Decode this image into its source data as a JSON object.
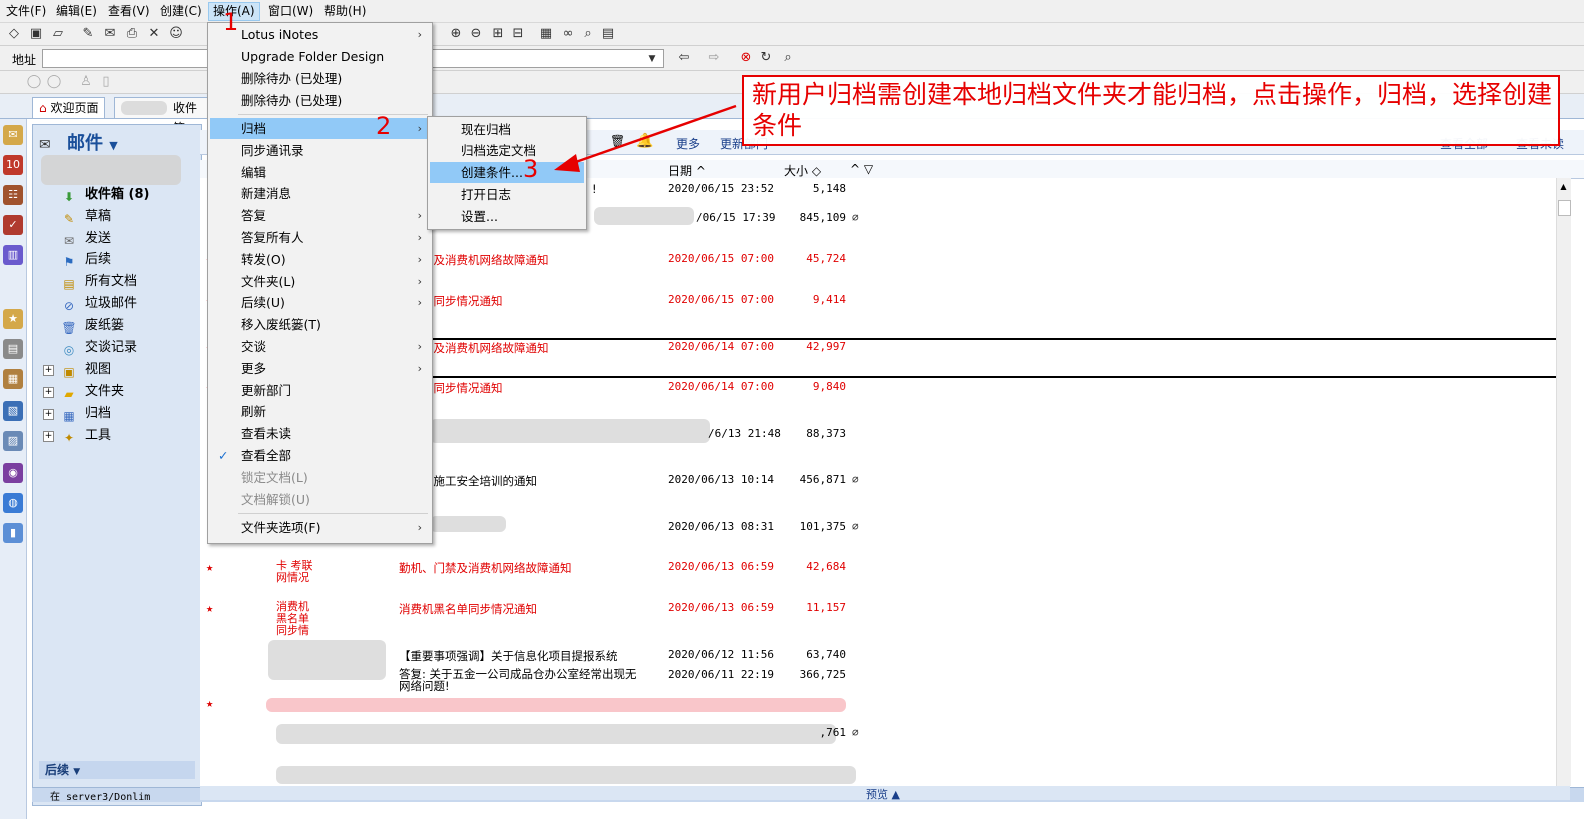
{
  "menubar": [
    {
      "label": "文件(F)"
    },
    {
      "label": "编辑(E)"
    },
    {
      "label": "查看(V)"
    },
    {
      "label": "创建(C)"
    },
    {
      "label": "操作(A)"
    },
    {
      "label": "窗口(W)"
    },
    {
      "label": "帮助(H)"
    }
  ],
  "address": {
    "label": "地址",
    "value": ""
  },
  "tabs": {
    "welcome": "欢迎页面",
    "inbox": "收件箱"
  },
  "nav": {
    "header": "邮件",
    "items": [
      {
        "label": "收件箱 (8)",
        "icon": "inbox-icon"
      },
      {
        "label": "草稿",
        "icon": "draft-icon"
      },
      {
        "label": "发送",
        "icon": "sent-icon"
      },
      {
        "label": "后续",
        "icon": "flag-icon"
      },
      {
        "label": "所有文档",
        "icon": "all-docs-icon"
      },
      {
        "label": "垃圾邮件",
        "icon": "junk-icon"
      },
      {
        "label": "废纸篓",
        "icon": "trash-icon"
      },
      {
        "label": "交谈记录",
        "icon": "conversations-icon"
      },
      {
        "label": "视图",
        "icon": "views-icon"
      },
      {
        "label": "文件夹",
        "icon": "folder-icon"
      },
      {
        "label": "归档",
        "icon": "archive-icon"
      },
      {
        "label": "工具",
        "icon": "tools-icon"
      }
    ],
    "followup": "后续",
    "status": "在 server3/Donlim"
  },
  "view_toolbar": {
    "more": "更多",
    "update_dept": "更新部门",
    "view_all": "查看全部",
    "view_unread": "查看未读"
  },
  "columns": {
    "date": "日期",
    "size": "大小"
  },
  "rows": [
    {
      "subject": "!",
      "date": "2020/06/15 23:52",
      "size": "5,148",
      "red": false,
      "star": false,
      "clip": false
    },
    {
      "subject": "",
      "date": "/06/15 17:39",
      "size": "845,109",
      "red": false,
      "star": false,
      "clip": true
    },
    {
      "subject": "、门禁及消费机网络故障通知",
      "date": "2020/06/15 07:00",
      "size": "45,724",
      "red": true,
      "star": true,
      "clip": false
    },
    {
      "subject": "黑名单同步情况通知",
      "date": "2020/06/15 07:00",
      "size": "9,414",
      "red": true,
      "star": true,
      "clip": false
    },
    {
      "subject": "、门禁及消费机网络故障通知",
      "date": "2020/06/14 07:00",
      "size": "42,997",
      "red": true,
      "star": true,
      "clip": false
    },
    {
      "subject": "黑名单同步情况通知",
      "date": "2020/06/14 07:00",
      "size": "9,840",
      "red": true,
      "star": true,
      "clip": false
    },
    {
      "subject": "",
      "date": "/6/13 21:48",
      "size": "88,373",
      "red": false,
      "star": false,
      "clip": false
    },
    {
      "subject": "电工程施工安全培训的通知",
      "date": "2020/06/13 10:14",
      "size": "456,871",
      "red": false,
      "star": false,
      "clip": true
    },
    {
      "subject": "",
      "date": "2020/06/13 08:31",
      "size": "101,375",
      "red": false,
      "star": false,
      "clip": true
    },
    {
      "subject": "勤机、门禁及消费机网络故障通知",
      "date": "2020/06/13 06:59",
      "size": "42,684",
      "red": true,
      "star": true,
      "clip": false,
      "who": "卡 考联 网情况"
    },
    {
      "subject": "消费机黑名单同步情况通知",
      "date": "2020/06/13 06:59",
      "size": "11,157",
      "red": true,
      "star": true,
      "clip": false,
      "who": "消费机 黑名单 同步情"
    },
    {
      "subject": "【重要事项强调】关于信息化项目提报系统",
      "date": "2020/06/12 11:56",
      "size": "63,740",
      "red": false,
      "star": false,
      "clip": false
    },
    {
      "subject": "答复: 关于五金一公司成品仓办公室经常出现无网络问题!",
      "date": "2020/06/11 22:19",
      "size": "366,725",
      "red": false,
      "star": false,
      "clip": false
    },
    {
      "subject": "",
      "date": "",
      "size": "",
      "red": true,
      "star": true,
      "clip": false
    },
    {
      "subject": "",
      "date": "",
      "size": ",761",
      "red": false,
      "star": false,
      "clip": true
    },
    {
      "subject": "",
      "date": "",
      "size": "",
      "red": false,
      "star": false,
      "clip": false
    }
  ],
  "preview_label": "预览",
  "action_menu": [
    {
      "label": "Lotus iNotes",
      "submenu": true
    },
    {
      "label": "Upgrade Folder Design",
      "submenu": false
    },
    {
      "label": "删除待办 (已处理)",
      "submenu": false
    },
    {
      "label": "删除待办 (已处理)",
      "submenu": false
    },
    {
      "label": "归档",
      "submenu": true,
      "highlight": true
    },
    {
      "label": "同步通讯录",
      "submenu": false
    },
    {
      "label": "编辑",
      "submenu": false
    },
    {
      "label": "新建消息",
      "submenu": false
    },
    {
      "label": "答复",
      "submenu": true
    },
    {
      "label": "答复所有人",
      "submenu": true
    },
    {
      "label": "转发(O)",
      "submenu": true
    },
    {
      "label": "文件夹(L)",
      "submenu": true
    },
    {
      "label": "后续(U)",
      "submenu": true
    },
    {
      "label": "移入废纸篓(T)",
      "submenu": false
    },
    {
      "label": "交谈",
      "submenu": true
    },
    {
      "label": "更多",
      "submenu": true
    },
    {
      "label": "更新部门",
      "submenu": false
    },
    {
      "label": "刷新",
      "submenu": false
    },
    {
      "label": "查看未读",
      "submenu": false
    },
    {
      "label": "查看全部",
      "submenu": false,
      "checked": true
    },
    {
      "label": "锁定文档(L)",
      "submenu": false,
      "disabled": true
    },
    {
      "label": "文档解锁(U)",
      "submenu": false,
      "disabled": true
    },
    {
      "label": "文件夹选项(F)",
      "submenu": true
    }
  ],
  "archive_submenu": [
    {
      "label": "现在归档"
    },
    {
      "label": "归档选定文档"
    },
    {
      "label": "创建条件...",
      "highlight": true
    },
    {
      "label": "打开日志"
    },
    {
      "label": "设置..."
    }
  ],
  "annotations": {
    "step1": "1",
    "step2": "2",
    "step3": "3",
    "note": "新用户归档需创建本地归档文件夹才能归档，点击操作，归档，选择创建条件"
  },
  "colors": {
    "annotation": "#e60000",
    "menu_highlight": "#91c9f7",
    "unread_red": "#e00000"
  }
}
